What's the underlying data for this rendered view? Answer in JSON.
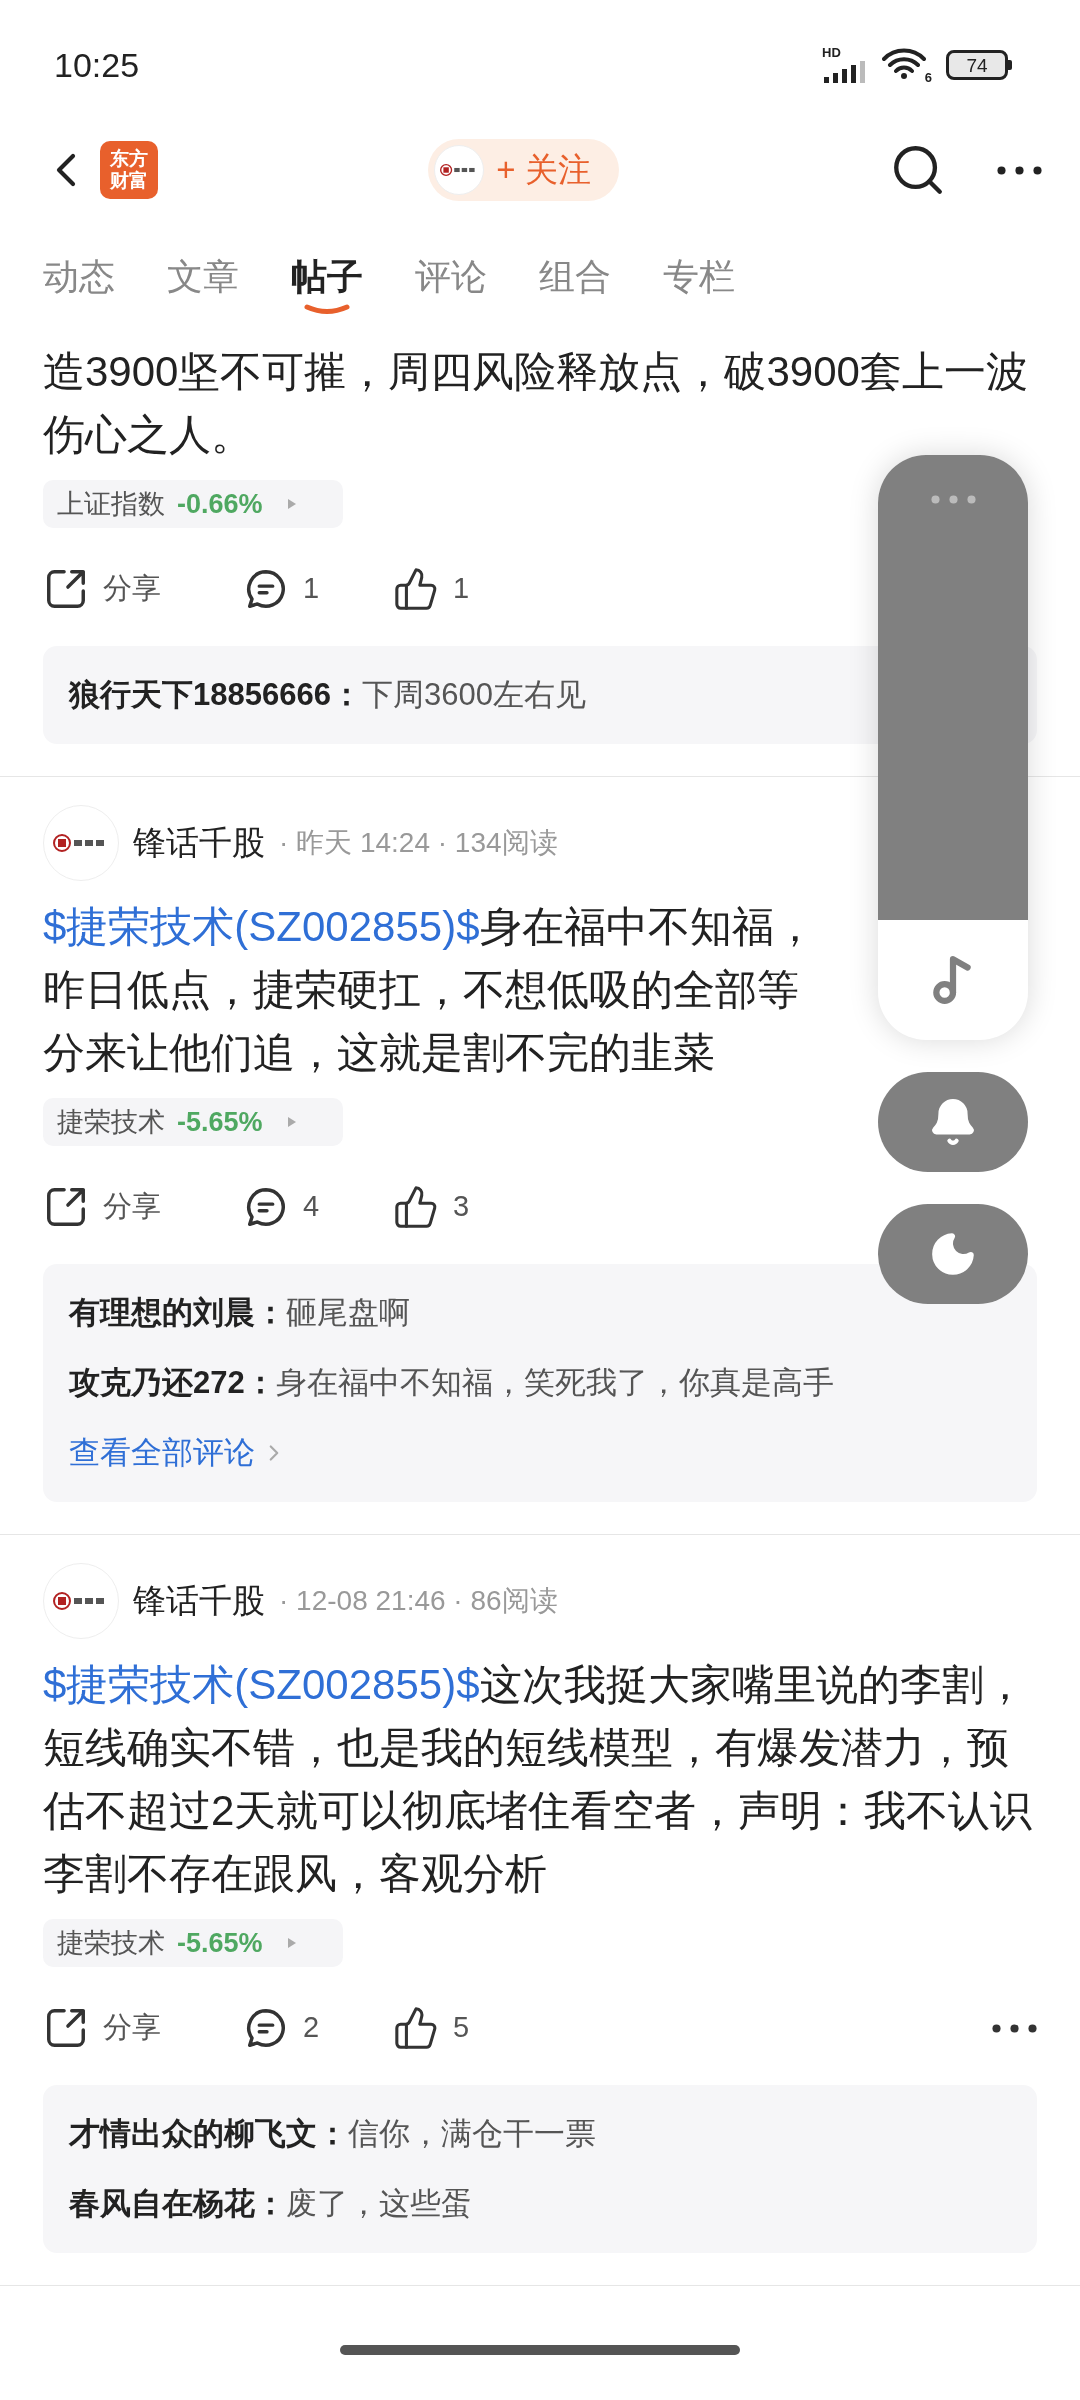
{
  "status_bar": {
    "time": "10:25",
    "network": "HD",
    "wifi_badge": "6",
    "battery": "74"
  },
  "header": {
    "logo_lines": [
      "东方",
      "财富"
    ],
    "follow_button": "+ 关注"
  },
  "tabs": [
    {
      "label": "动态",
      "selected": false
    },
    {
      "label": "文章",
      "selected": false
    },
    {
      "label": "帖子",
      "selected": true
    },
    {
      "label": "评论",
      "selected": false
    },
    {
      "label": "组合",
      "selected": false
    },
    {
      "label": "专栏",
      "selected": false
    }
  ],
  "posts": [
    {
      "body_text": "造3900坚不可摧，周四风险释放点，破3900套上一波伤心之人。",
      "stock_tag": {
        "name": "上证指数",
        "change": "-0.66%"
      },
      "actions": {
        "share": "分享",
        "comments": "1",
        "likes": "1"
      },
      "more_button": false,
      "comments": [
        {
          "user": "狼行天下18856666：",
          "text": "下周3600左右见"
        }
      ]
    },
    {
      "author": "锋话千股",
      "meta": "· 昨天 14:24 · 134阅读",
      "body_link": "$捷荣技术(SZ002855)$",
      "body_text": "身在福中不知福，昨日低点，捷荣硬扛，不想低吸的全部等分来让他们追，这就是割不完的韭菜",
      "stock_tag": {
        "name": "捷荣技术",
        "change": "-5.65%"
      },
      "actions": {
        "share": "分享",
        "comments": "4",
        "likes": "3"
      },
      "more_button": false,
      "comments": [
        {
          "user": "有理想的刘晨：",
          "text": "砸尾盘啊"
        },
        {
          "user": "攻克乃还272：",
          "text": "身在福中不知福，笑死我了，你真是高手"
        }
      ],
      "view_all": "查看全部评论"
    },
    {
      "author": "锋话千股",
      "meta": "· 12-08 21:46 · 86阅读",
      "body_link": "$捷荣技术(SZ002855)$",
      "body_text": "这次我挺大家嘴里说的李割，短线确实不错，也是我的短线模型，有爆发潜力，预估不超过2天就可以彻底堵住看空者，声明：我不认识李割不存在跟风，客观分析",
      "stock_tag": {
        "name": "捷荣技术",
        "change": "-5.65%"
      },
      "actions": {
        "share": "分享",
        "comments": "2",
        "likes": "5"
      },
      "more_button": true,
      "comments": [
        {
          "user": "才情出众的柳飞文：",
          "text": "信你，满仓干一票"
        },
        {
          "user": "春风自在杨花：",
          "text": "废了，这些蛋"
        }
      ]
    }
  ]
}
